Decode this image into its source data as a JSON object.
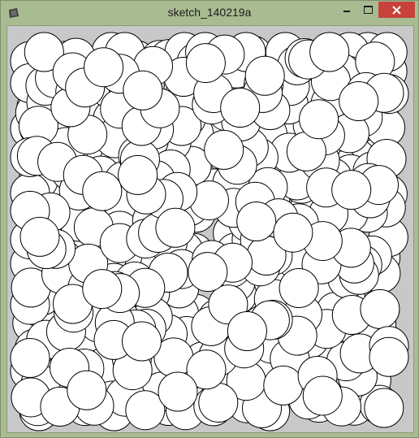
{
  "window": {
    "title": "sketch_140219a",
    "controls": {
      "minimize": "minimize",
      "maximize": "maximize",
      "close": "close"
    }
  },
  "colors": {
    "frame": "#a9bc91",
    "canvas_background": "#c8c8c8",
    "circle_fill": "#ffffff",
    "circle_stroke": "#000000",
    "close_button": "#c7423b"
  },
  "icons": {
    "app": "processing-sketch-icon",
    "minimize": "minimize-icon",
    "maximize": "maximize-icon",
    "close": "close-icon"
  },
  "sketch": {
    "shape": "circle",
    "description_visible": false
  }
}
